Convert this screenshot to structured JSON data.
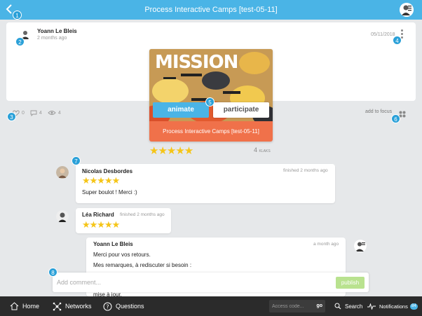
{
  "header": {
    "title": "Process Interactive Camps [test-05-11]"
  },
  "badges": [
    "1",
    "2",
    "3",
    "4",
    "5",
    "6",
    "7",
    "8"
  ],
  "post": {
    "author": "Yoann Le Bleis",
    "time": "2 months ago",
    "date": "05/11/2018",
    "likes": "0",
    "comments": "4",
    "views": "4",
    "add_to_focus": "add to focus"
  },
  "mission": {
    "image_word": "MISSION",
    "title": "Process Interactive Camps [test-05-11]",
    "animate": "animate",
    "participate": "participate",
    "rating": 5,
    "stars": "★★★★★",
    "klaks_count": "4",
    "klaks_label": "KLAKS"
  },
  "comments": [
    {
      "name": "Nicolas Desbordes",
      "time": "finished 2 months ago",
      "stars": "★★★★★",
      "text": "Super boulot ! Merci :)"
    },
    {
      "name": "Léa Richard",
      "time": "finished 2 months ago",
      "stars": "★★★★★"
    },
    {
      "name": "Yoann Le Bleis",
      "time": "a month ago",
      "lines": [
        "Merci pour vos retours.",
        "Mes remarques, à rediscuter si besoin :",
        "mise à jour."
      ]
    }
  ],
  "composer": {
    "placeholder": "Add comment...",
    "publish": "publish"
  },
  "nav": {
    "home": "Home",
    "networks": "Networks",
    "questions": "Questions",
    "access_placeholder": "Access code...",
    "go": "go",
    "search": "Search",
    "notifications": "Notifications",
    "notifications_count": "84"
  },
  "colors": {
    "topbar": "#4ab4e6",
    "accent_orange": "#f0714a",
    "star": "#f5c518",
    "bottombar": "#2b2b2b",
    "publish": "#b9e28f"
  }
}
